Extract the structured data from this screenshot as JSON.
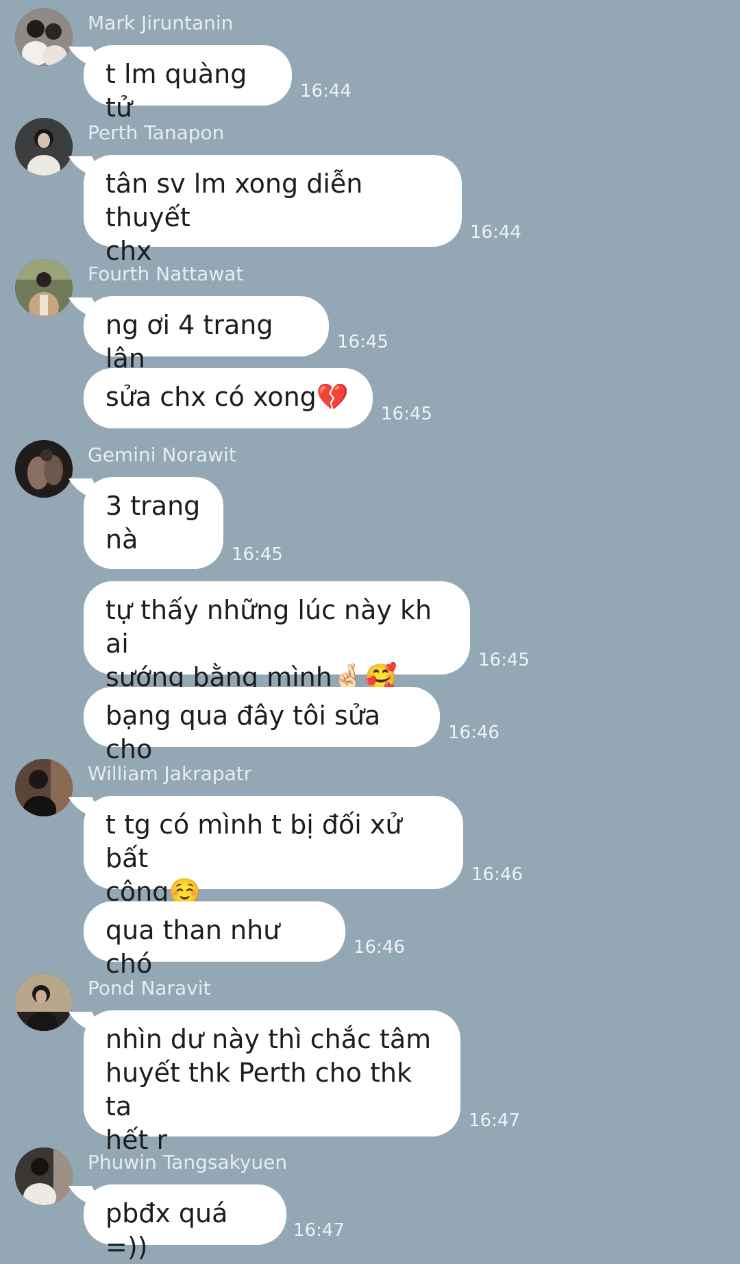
{
  "messages": [
    {
      "sender": "Mark Jiruntanin",
      "text": "t lm quàng tử",
      "time": "16:44",
      "avatar": "avatar-mark"
    },
    {
      "sender": "Perth Tanapon",
      "text": "tân sv lm xong diễn thuyết\nchx",
      "time": "16:44",
      "avatar": "avatar-perth"
    },
    {
      "sender": "Fourth Nattawat",
      "text": "ng ơi 4 trang lận",
      "time": "16:45",
      "avatar": "avatar-fourth"
    },
    {
      "text": "sửa chx có xong💔",
      "time": "16:45"
    },
    {
      "sender": "Gemini Norawit",
      "text": "3 trang\nnà",
      "time": "16:45",
      "avatar": "avatar-gemini"
    },
    {
      "text": "tự thấy những lúc này kh ai\nsướng bằng mình🤞🏻🥰",
      "time": "16:45"
    },
    {
      "text": "bạng qua đây tôi sửa cho",
      "time": "16:46"
    },
    {
      "sender": "William Jakrapatr",
      "text": "t tg có mình t bị đối xử bất\ncông☺️",
      "time": "16:46",
      "avatar": "avatar-william"
    },
    {
      "text": "qua than như chó",
      "time": "16:46"
    },
    {
      "sender": "Pond Naravit",
      "text": "nhìn dư này thì chắc tâm\nhuyết thk Perth cho thk ta\nhết r",
      "time": "16:47",
      "avatar": "avatar-pond"
    },
    {
      "sender": "Phuwin Tangsakyuen",
      "text": "pbđx quá =))",
      "time": "16:47",
      "avatar": "avatar-phuwin"
    }
  ]
}
